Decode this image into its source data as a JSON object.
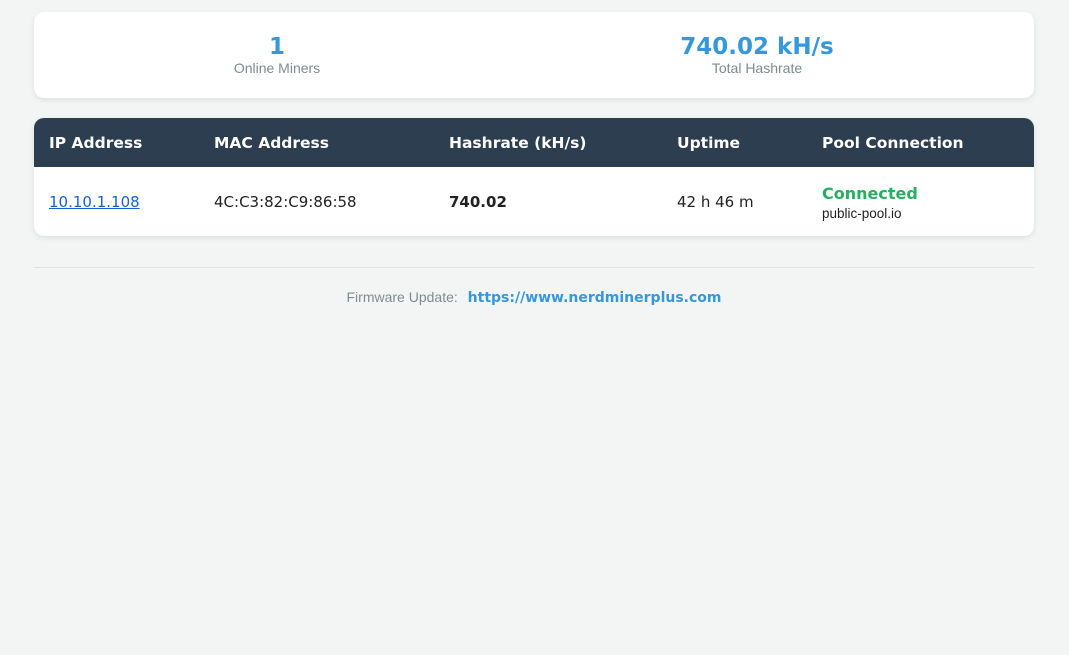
{
  "stats": {
    "online_miners_value": "1",
    "online_miners_label": "Online Miners",
    "total_hashrate_value": "740.02 kH/s",
    "total_hashrate_label": "Total Hashrate"
  },
  "table": {
    "headers": [
      "IP Address",
      "MAC Address",
      "Hashrate (kH/s)",
      "Uptime",
      "Pool Connection"
    ],
    "rows": [
      {
        "ip": "10.10.1.108",
        "mac": "4C:C3:82:C9:86:58",
        "hashrate": "740.02",
        "uptime": "42 h 46 m",
        "pool_status": "Connected",
        "pool_name": "public-pool.io"
      }
    ]
  },
  "footer": {
    "label": "Firmware Update:",
    "link_text": "https://www.nerdminerplus.com"
  },
  "colors": {
    "accent": "#3498db",
    "header_bg": "#2c3e50",
    "connected": "#27ae60",
    "page_bg": "#f3f5f4"
  }
}
